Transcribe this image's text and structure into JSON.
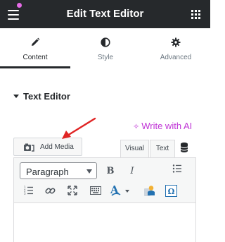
{
  "header": {
    "title": "Edit Text Editor",
    "menu_icon": "hamburger-menu-icon",
    "apps_icon": "grid-icon",
    "notification_color": "#e56be6"
  },
  "tabs": [
    {
      "label": "Content",
      "icon": "pencil-icon",
      "active": true
    },
    {
      "label": "Style",
      "icon": "half-circle-icon",
      "active": false
    },
    {
      "label": "Advanced",
      "icon": "gear-icon",
      "active": false
    }
  ],
  "section": {
    "title": "Text Editor",
    "expanded": true
  },
  "ai": {
    "label": "Write with AI",
    "icon": "sparkle-icon",
    "color": "#c036d6"
  },
  "editor": {
    "add_media_label": "Add Media",
    "mode_tabs": [
      "Visual",
      "Text"
    ],
    "active_mode": "Visual",
    "format_select": "Paragraph",
    "toolbar_row1": [
      "bold-icon",
      "italic-icon",
      "bulleted-list-icon"
    ],
    "toolbar_row2": [
      "numbered-list-icon",
      "link-icon",
      "fullscreen-icon",
      "keyboard-icon",
      "text-color-icon",
      "paste-icon",
      "special-characters-icon"
    ],
    "content": ""
  },
  "colors": {
    "header_bg": "#26292c",
    "annotation_arrow": "#e02424"
  }
}
